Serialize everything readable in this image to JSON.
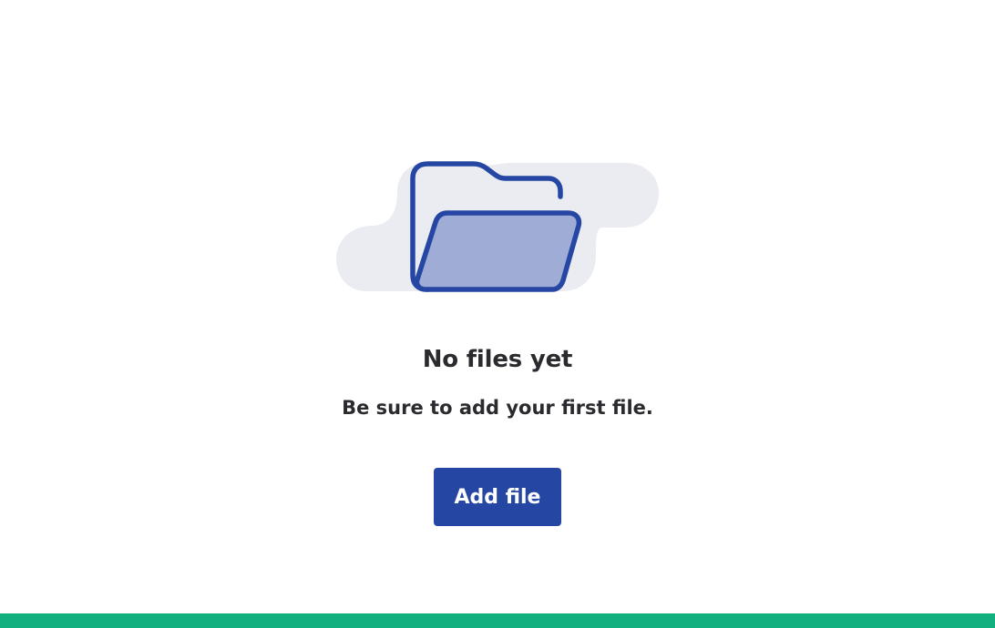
{
  "empty_state": {
    "illustration_icon": "open-folder-icon",
    "title": "No files yet",
    "subtitle": "Be sure to add your first file.",
    "add_button_label": "Add file"
  },
  "colors": {
    "button_background": "#2546a3",
    "folder_stroke": "#2546a3",
    "folder_fill": "#9eacd6",
    "cloud": "#ebecf2",
    "bottom_bar": "#12b07f",
    "text": "#2b2b2f"
  }
}
